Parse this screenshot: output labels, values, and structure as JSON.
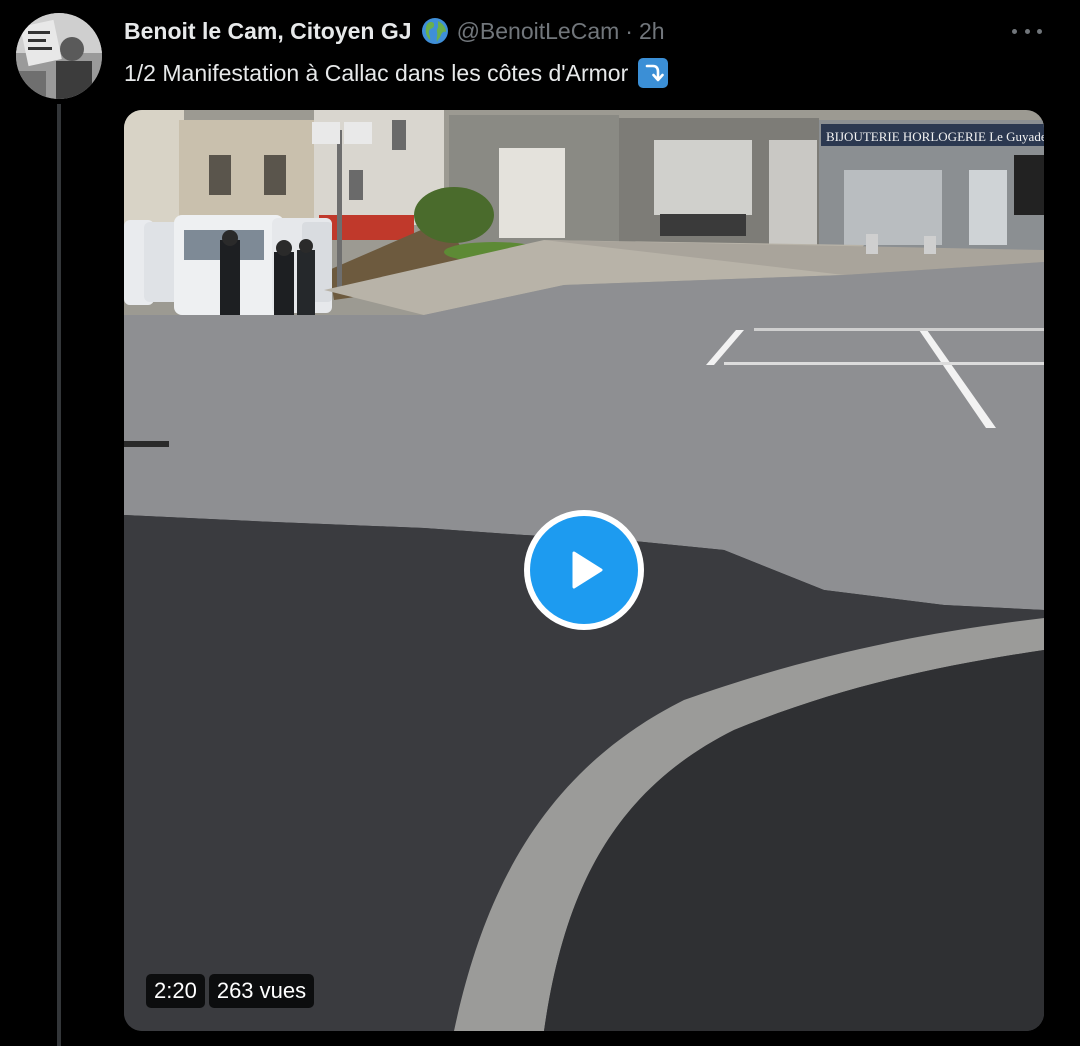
{
  "author": {
    "display_name": "Benoit le Cam, Citoyen GJ",
    "badge_icon": "globe-icon",
    "handle": "@BenoitLeCam",
    "separator": "·",
    "time": "2h"
  },
  "tweet": {
    "text": "1/2 Manifestation à Callac dans les côtes d'Armor",
    "trailing_icon": "arrow-turn-down-icon"
  },
  "media": {
    "shop_sign": "BIJOUTERIE HORLOGERIE  Le Guyader",
    "duration": "2:20",
    "views": "263 vues"
  },
  "colors": {
    "background": "#000000",
    "text_primary": "#e7e9ea",
    "text_secondary": "#71767b",
    "accent": "#1d9bf0"
  }
}
